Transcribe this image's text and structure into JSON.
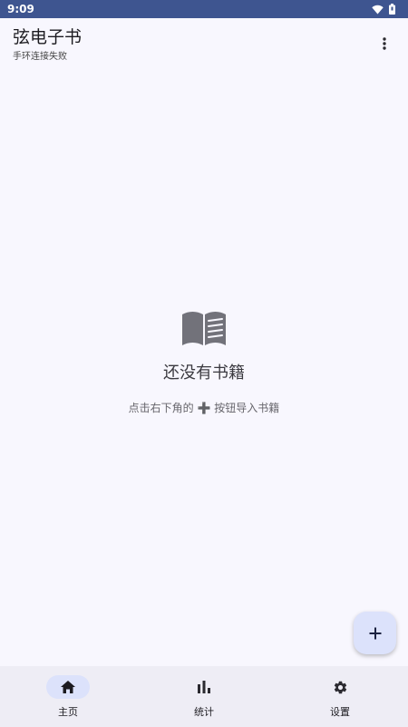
{
  "status_bar": {
    "time": "9:09"
  },
  "app_bar": {
    "title": "弦电子书",
    "subtitle": "手环连接失败",
    "more_icon": "more-vert-icon"
  },
  "empty_state": {
    "icon": "book-open-icon",
    "title": "还没有书籍",
    "hint_before": "点击右下角的",
    "hint_glyph": "➕",
    "hint_after": "按钮导入书籍"
  },
  "fab": {
    "icon": "add-icon",
    "label": "+"
  },
  "bottom_nav": {
    "items": [
      {
        "label": "主页",
        "icon": "home-icon",
        "active": true
      },
      {
        "label": "统计",
        "icon": "bar-chart-icon",
        "active": false
      },
      {
        "label": "设置",
        "icon": "settings-icon",
        "active": false
      }
    ]
  },
  "colors": {
    "status_bar": "#3e5590",
    "background": "#f8f7fe",
    "fab": "#dce2fb",
    "nav_bar": "#eeedf5",
    "nav_active_pill": "#dce2fb"
  }
}
